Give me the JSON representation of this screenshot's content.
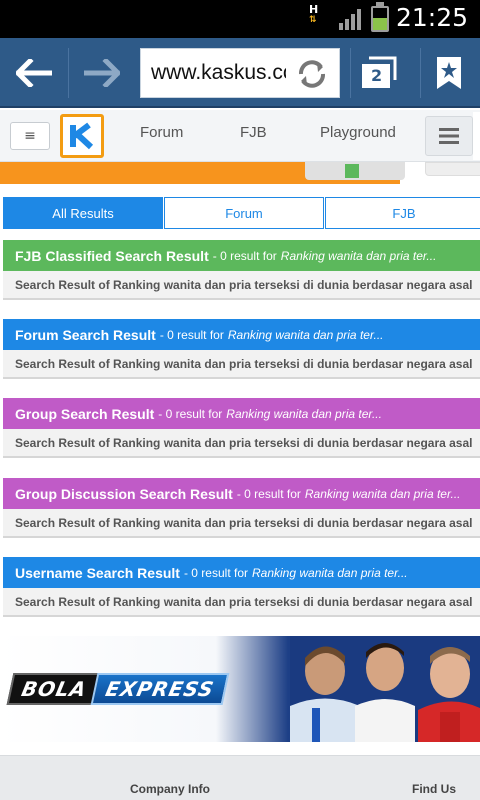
{
  "status_bar": {
    "network_type": "H",
    "time": "21:25",
    "battery_level": 0.55,
    "battery_color": "#8bc34a"
  },
  "browser": {
    "url": "www.kaskus.co.id",
    "tab_count": "2",
    "back_icon": "back-arrow-icon",
    "forward_icon": "forward-arrow-icon",
    "reload_icon": "reload-icon",
    "tabs_icon": "tabs-icon",
    "bookmark_icon": "bookmark-star-icon",
    "bar_color": "#2e5a88"
  },
  "site_nav": {
    "logo": "K",
    "links": [
      "Forum",
      "FJB",
      "Playground"
    ],
    "brand_color": "#f39c12"
  },
  "result_tabs": [
    {
      "label": "All Results",
      "active": true
    },
    {
      "label": "Forum",
      "active": false
    },
    {
      "label": "FJB",
      "active": false
    }
  ],
  "results": [
    {
      "title": "FJB Classified Search Result",
      "meta": "- 0 result for",
      "query": "Ranking wanita dan pria ter...",
      "body": "Search Result of Ranking wanita dan pria terseksi di dunia berdasar negara asal",
      "color": "#5cb85c"
    },
    {
      "title": "Forum Search Result",
      "meta": "- 0 result for",
      "query": "Ranking wanita dan pria ter...",
      "body": "Search Result of Ranking wanita dan pria terseksi di dunia berdasar negara asal",
      "color": "#1e88e5"
    },
    {
      "title": "Group Search Result",
      "meta": "- 0 result for",
      "query": "Ranking wanita dan pria ter...",
      "body": "Search Result of Ranking wanita dan pria terseksi di dunia berdasar negara asal",
      "color": "#c05bc7"
    },
    {
      "title": "Group Discussion Search Result",
      "meta": "- 0 result for",
      "query": "Ranking wanita dan pria ter...",
      "body": "Search Result of Ranking wanita dan pria terseksi di dunia berdasar negara asal",
      "color": "#c05bc7"
    },
    {
      "title": "Username Search Result",
      "meta": "- 0 result for",
      "query": "Ranking wanita dan pria ter...",
      "body": "Search Result of Ranking wanita dan pria terseksi di dunia berdasar negara asal",
      "color": "#1e88e5"
    }
  ],
  "ad": {
    "brand_part1": "BOLA",
    "brand_part2": "EXPRESS"
  },
  "footer": {
    "company_info": "Company Info",
    "find_us": "Find Us"
  }
}
